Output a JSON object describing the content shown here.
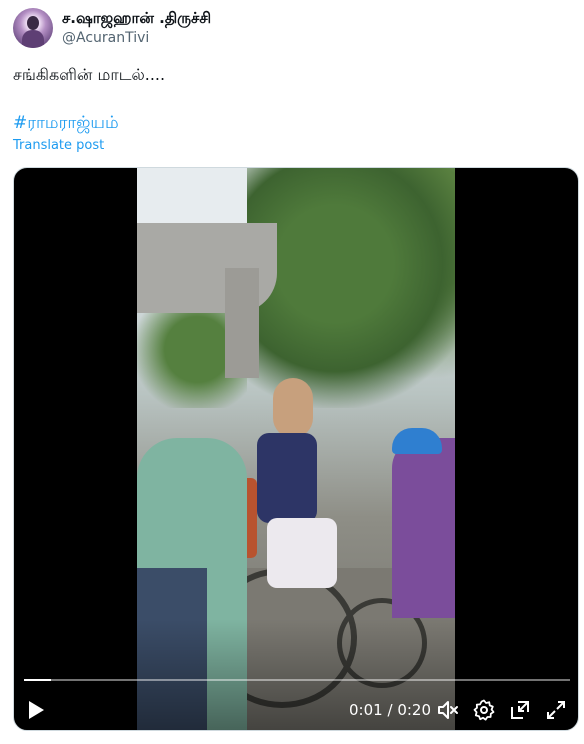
{
  "author": {
    "display_name": "ச.ஷாஜஹான் .திருச்சி",
    "handle": "@AcuranTivi"
  },
  "tweet": {
    "text": "சங்கிகளின் மாடல்....",
    "hashtag": "#ராமராஜ்யம்",
    "translate_label": "Translate post"
  },
  "video": {
    "current_time": "0:01",
    "separator": "/",
    "duration": "0:20",
    "progress_fraction": 0.05
  },
  "icons": {
    "play": "play-icon",
    "mute": "volume-muted-icon",
    "settings": "gear-icon",
    "pip": "picture-in-picture-icon",
    "fullscreen": "fullscreen-icon"
  }
}
